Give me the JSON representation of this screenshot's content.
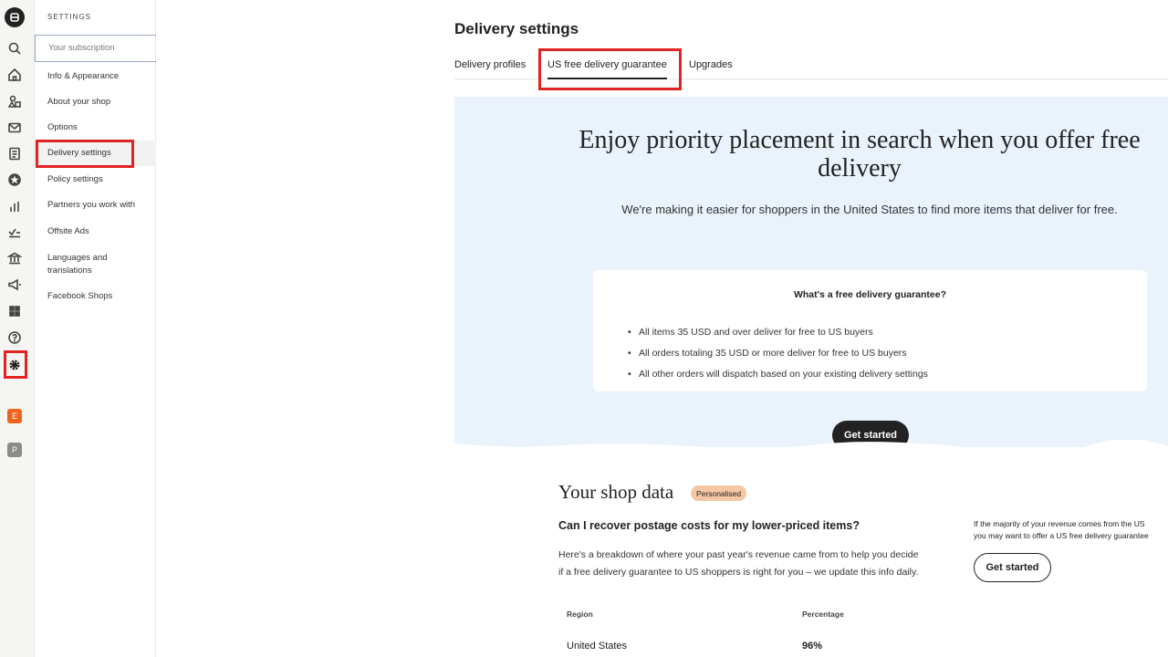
{
  "settings_nav": {
    "header": "SETTINGS",
    "items": [
      {
        "label": "Your subscription"
      },
      {
        "label": "Info & Appearance"
      },
      {
        "label": "About your shop"
      },
      {
        "label": "Options"
      },
      {
        "label": "Delivery settings"
      },
      {
        "label": "Policy settings"
      },
      {
        "label": "Partners you work with"
      },
      {
        "label": "Offsite Ads"
      },
      {
        "label": "Languages and translations"
      },
      {
        "label": "Facebook Shops"
      }
    ]
  },
  "rail": {
    "badges": [
      {
        "letter": "E",
        "color": "#f1641e"
      },
      {
        "letter": "P",
        "color": "#8a8a8a"
      }
    ],
    "icons": [
      "shop-logo-icon",
      "search-icon",
      "home-icon",
      "listings-icon",
      "messages-icon",
      "orders-icon",
      "star-icon",
      "stats-icon",
      "trending-icon",
      "finances-icon",
      "marketing-icon",
      "apps-icon",
      "help-icon",
      "settings-icon"
    ]
  },
  "page": {
    "title": "Delivery settings",
    "tabs": [
      {
        "label": "Delivery profiles"
      },
      {
        "label": "US free delivery guarantee"
      },
      {
        "label": "Upgrades"
      }
    ]
  },
  "hero": {
    "heading": "Enjoy priority placement in search when you offer free delivery",
    "subtext": "We're making it easier for shoppers in the United States to find more items that deliver for free.",
    "card_title": "What's a free delivery guarantee?",
    "bullets": [
      "All items 35 USD and over deliver for free to US buyers",
      "All orders totaling 35 USD or more deliver for free to US buyers",
      "All other orders will dispatch based on your existing delivery settings"
    ],
    "cta": "Get started"
  },
  "shop_data": {
    "title": "Your shop data",
    "badge": "Personalised",
    "question": "Can I recover postage costs for my lower-priced items?",
    "paragraph": "Here's a breakdown of where your past year's revenue came from to help you decide if a free delivery guarantee to US shoppers is right for you – we update this info daily.",
    "table": {
      "headers": [
        "Region",
        "Percentage"
      ],
      "rows": [
        [
          "United States",
          "96%"
        ]
      ]
    },
    "side_note_line1": "If the majority of your revenue comes from the US",
    "side_note_line2": "you may want to offer a US free delivery guarantee",
    "side_cta": "Get started"
  },
  "colors": {
    "highlight": "#e02424",
    "hero_bg": "#eaf2fb",
    "badge_bg": "#f6c7a4"
  }
}
